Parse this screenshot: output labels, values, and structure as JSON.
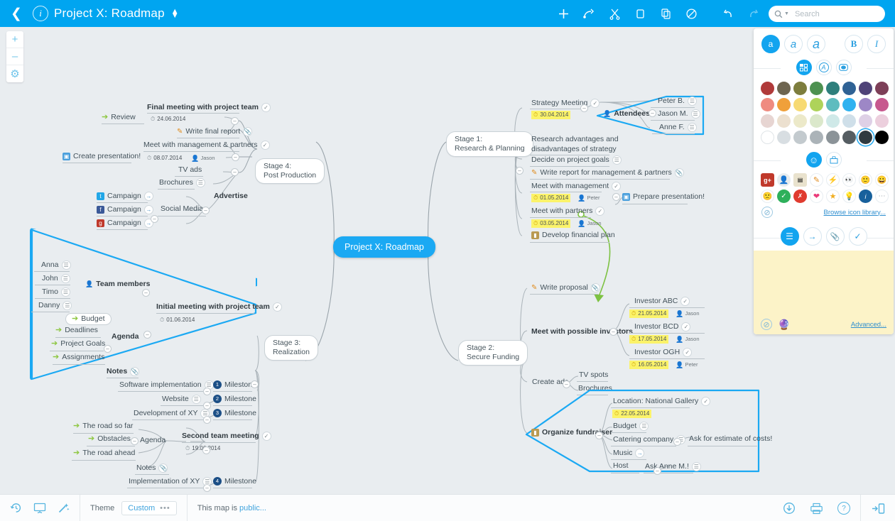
{
  "header": {
    "back_icon": "chevron-left-icon",
    "info_icon": "info-icon",
    "title": "Project X: Roadmap",
    "title_caret": "updown-caret-icon",
    "tools": [
      {
        "name": "add-node-button",
        "glyph": "+"
      },
      {
        "name": "add-relationship-button",
        "glyph": "relationship"
      },
      {
        "name": "cut-button",
        "glyph": "scissors"
      },
      {
        "name": "copy-button",
        "glyph": "copy"
      },
      {
        "name": "paste-button",
        "glyph": "paste"
      },
      {
        "name": "delete-button",
        "glyph": "no-entry"
      },
      {
        "name": "undo-button",
        "glyph": "undo"
      },
      {
        "name": "redo-button",
        "glyph": "redo"
      }
    ],
    "search": {
      "placeholder": "Search",
      "value": "",
      "icon": "search-icon"
    }
  },
  "zoom_controls": [
    {
      "name": "zoom-in-button",
      "glyph": "+"
    },
    {
      "name": "zoom-out-button",
      "glyph": "–"
    },
    {
      "name": "canvas-settings-button",
      "glyph": "gear"
    }
  ],
  "map": {
    "root": "Project X: Roadmap",
    "accent_color": "#1ba9f3",
    "canvas_color": "#e9edf0",
    "stages": [
      {
        "id": "stage1",
        "label": "Stage 1:\nResearch & Planning",
        "line1": "Stage 1:",
        "line2": "Research & Planning"
      },
      {
        "id": "stage2",
        "label": "Stage 2:\nSecure Funding",
        "line1": "Stage 2:",
        "line2": "Secure Funding"
      },
      {
        "id": "stage3",
        "label": "Stage 3:\nRealization",
        "line1": "Stage 3:",
        "line2": "Realization"
      },
      {
        "id": "stage4",
        "label": "Stage 4:\nPost Production",
        "line1": "Stage 4:",
        "line2": "Post Production"
      }
    ],
    "nodes": {
      "final_meeting": "Final meeting with project team",
      "final_meeting_date": "24.06.2014",
      "review": "Review",
      "write_final_report": "Write final report",
      "meet_management_partners": "Meet with management & partners",
      "meet_mp_date": "08.07.2014",
      "meet_mp_who": "Jason",
      "create_presentation": "Create presentation!",
      "tv_ads": "TV ads",
      "brochures": "Brochures",
      "advertise": "Advertise",
      "social_media": "Social Media",
      "campaign_tw": "Campaign",
      "campaign_fb": "Campaign",
      "campaign_gp": "Campaign",
      "anna": "Anna",
      "john": "John",
      "timo": "Timo",
      "danny": "Danny",
      "team_members": "Team members",
      "budget": "Budget",
      "deadlines": "Deadlines",
      "project_goals": "Project Goals",
      "assignments": "Assignments",
      "agenda1": "Agenda",
      "notes1": "Notes",
      "initial_meeting": "Initial meeting with project team",
      "initial_meeting_date": "01.06.2014",
      "software_implementation": "Software implementation",
      "milestone1": "Milestone",
      "website": "Website",
      "milestone2": "Milestone",
      "development_xy": "Development of XY",
      "milestone3": "Milestone",
      "road_so_far": "The road so far",
      "obstacles": "Obstacles",
      "road_ahead": "The road ahead",
      "agenda2": "Agenda",
      "second_team_meeting": "Second team meeting",
      "second_team_meeting_date": "19.06.2014",
      "notes2": "Notes",
      "implementation_xy": "Implementation of XY",
      "milestone4": "Milestone",
      "strategy_meeting": "Strategy Meeting",
      "strategy_meeting_date": "30.04.2014",
      "attendees": "Attendees",
      "peter_b": "Peter B.",
      "jason_m": "Jason M.",
      "anne_f": "Anne F.",
      "research_adv": "Research advantages and",
      "research_adv2": "disadvantages of strategy",
      "decide_goals": "Decide on project goals",
      "write_report": "Write report for management & partners",
      "meet_management": "Meet with management",
      "meet_management_date": "01.05.2014",
      "meet_management_who": "Peter",
      "prepare_presentation": "Prepare presentation!",
      "meet_partners": "Meet with partners",
      "meet_partners_date": "03.05.2014",
      "meet_partners_who": "Jason",
      "develop_financial_plan": "Develop financial plan",
      "write_proposal": "Write proposal",
      "meet_investors": "Meet with possible investors",
      "investor_abc": "Investor ABC",
      "investor_abc_date": "21.05.2014",
      "investor_abc_who": "Jason",
      "investor_bcd": "Investor BCD",
      "investor_bcd_date": "17.05.2014",
      "investor_bcd_who": "Jason",
      "investor_ogh": "Investor OGH",
      "investor_ogh_date": "16.05.2014",
      "investor_ogh_who": "Peter",
      "create_ads": "Create ads",
      "tv_spots": "TV spots",
      "brochures2": "Brochures",
      "organize_fundraiser": "Organize fundraiser",
      "location": "Location: National Gallery",
      "location_date": "22.05.2014",
      "budget2": "Budget",
      "catering_company": "Catering company",
      "ask_estimate": "Ask for estimate of costs!",
      "music": "Music",
      "host": "Host",
      "ask_anne": "Ask Anne M.!"
    }
  },
  "panel": {
    "font_sizes": [
      {
        "name": "font-size-small",
        "glyph": "a",
        "active": true
      },
      {
        "name": "font-size-medium",
        "glyph": "a",
        "active": false
      },
      {
        "name": "font-size-large",
        "glyph": "a",
        "active": false
      }
    ],
    "bold_label": "B",
    "italic_label": "I",
    "style_tabs": [
      {
        "name": "tab-node-fill",
        "glyph": "fill",
        "active": true
      },
      {
        "name": "tab-text-color",
        "glyph": "A",
        "active": false
      },
      {
        "name": "tab-border-color",
        "glyph": "border",
        "active": false
      }
    ],
    "selected_swatch_index": 30,
    "swatches": [
      "#b03a3a",
      "#6e6550",
      "#7d7d3d",
      "#4d9150",
      "#2e7f7c",
      "#2f6295",
      "#4f4378",
      "#7d3f58",
      "#ef8b80",
      "#f0a03a",
      "#f7da73",
      "#aed35a",
      "#5fbcbf",
      "#2fb2f0",
      "#9d87c6",
      "#c7588e",
      "#e7d5d2",
      "#ece0cf",
      "#ece9c9",
      "#dbe8cb",
      "#cfe9e8",
      "#cfdfe9",
      "#ded0e6",
      "#eccfdd",
      "#ffffff",
      "#d8dee2",
      "#c3cace",
      "#abb3b8",
      "#8b9398",
      "#555d62",
      "#2f3a40",
      "#000000"
    ],
    "icon_tabs": [
      {
        "name": "tab-emoji-icons",
        "glyph": "smiley",
        "active": true
      },
      {
        "name": "tab-stickers",
        "glyph": "sticker",
        "active": false
      }
    ],
    "icons": [
      {
        "name": "google-plus-icon",
        "glyph": "g+"
      },
      {
        "name": "person-icon",
        "glyph": "person"
      },
      {
        "name": "money-icon",
        "glyph": "money"
      },
      {
        "name": "pencil-icon",
        "glyph": "pencil"
      },
      {
        "name": "lightning-icon",
        "glyph": "bolt"
      },
      {
        "name": "eyes-icon",
        "glyph": "eyes"
      },
      {
        "name": "smile-icon",
        "glyph": "smile"
      },
      {
        "name": "grin-icon",
        "glyph": "grin"
      },
      {
        "name": "sad-icon",
        "glyph": "sad"
      },
      {
        "name": "check-circle-icon",
        "glyph": "check"
      },
      {
        "name": "cross-circle-icon",
        "glyph": "cross"
      },
      {
        "name": "heart-icon",
        "glyph": "heart"
      },
      {
        "name": "star-icon",
        "glyph": "star"
      },
      {
        "name": "bulb-icon",
        "glyph": "bulb"
      },
      {
        "name": "info-badge-icon",
        "glyph": "info"
      },
      {
        "name": "more-icons-icon",
        "glyph": "dots"
      }
    ],
    "no_icon_label": "no-icon",
    "browse_link": "Browse icon library...",
    "attr_tabs": [
      {
        "name": "tab-note",
        "glyph": "note",
        "active": true
      },
      {
        "name": "tab-link",
        "glyph": "arrow",
        "active": false
      },
      {
        "name": "tab-attachment",
        "glyph": "clip",
        "active": false
      },
      {
        "name": "tab-task",
        "glyph": "check",
        "active": false
      }
    ],
    "note_value": "",
    "advanced_link": "Advanced...",
    "note_clear_icon": "clear-icon",
    "note_magic_icon": "magic-wand-icon"
  },
  "footer": {
    "left_tools": [
      {
        "name": "history-button",
        "glyph": "history"
      },
      {
        "name": "presentation-button",
        "glyph": "presentation"
      },
      {
        "name": "magic-button",
        "glyph": "magic"
      }
    ],
    "theme_label": "Theme",
    "theme_value": "Custom",
    "theme_dots": "•••",
    "share_prefix": "This map is ",
    "share_link": "public...",
    "right_tools": [
      {
        "name": "download-button",
        "glyph": "download"
      },
      {
        "name": "print-button",
        "glyph": "print"
      },
      {
        "name": "help-button",
        "glyph": "?"
      },
      {
        "name": "collapse-panel-button",
        "glyph": "panel"
      }
    ]
  }
}
